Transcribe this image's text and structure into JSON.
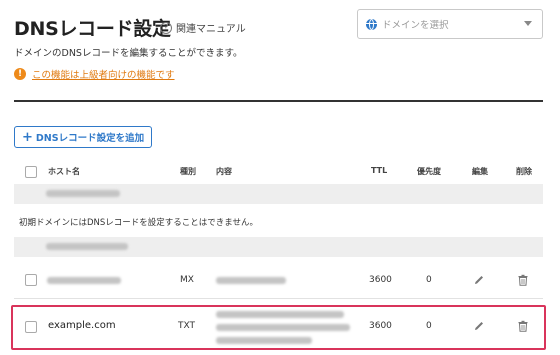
{
  "header": {
    "title": "DNSレコード設定",
    "help_label": "関連マニュアル",
    "domain_select_placeholder": "ドメインを選択"
  },
  "description": "ドメインのDNSレコードを編集することができます。",
  "warning": {
    "icon": "!",
    "text": "この機能は上級者向けの機能です"
  },
  "toolbar": {
    "add_label": "DNSレコード設定を追加"
  },
  "table": {
    "columns": [
      "ホスト名",
      "種別",
      "内容",
      "TTL",
      "優先度",
      "編集",
      "削除"
    ],
    "notice": "初期ドメインにはDNSレコードを設定することはできません。",
    "rows": [
      {
        "host": "",
        "type": "MX",
        "content": "",
        "ttl": "3600",
        "priority": "0"
      },
      {
        "host": "example.com",
        "type": "TXT",
        "content": "",
        "ttl": "3600",
        "priority": "0"
      }
    ]
  },
  "colors": {
    "accent": "#2f79c9",
    "warning": "#e07a10",
    "highlight": "#d9345b"
  },
  "icons": {
    "edit": "pencil-icon",
    "delete": "trash-icon",
    "select": "globe-icon"
  }
}
